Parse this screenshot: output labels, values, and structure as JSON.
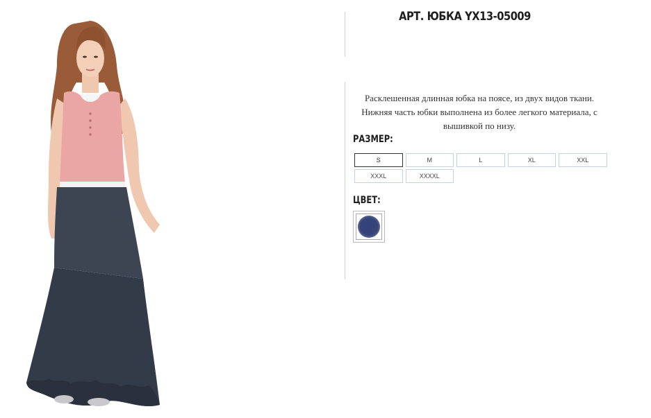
{
  "product": {
    "title": "АРТ. ЮБКА YX13-05009",
    "description": "Расклешенная длинная юбка на поясе, из двух видов ткани. Нижняя часть юбки выполнена из более легкого материала, с вышивкой по низу.",
    "photo_icon": "product-photo"
  },
  "size_section": {
    "label": "РАЗМЕР:",
    "options": [
      "S",
      "M",
      "L",
      "XL",
      "XXL",
      "XXXL",
      "XXXXL"
    ],
    "selected": "S"
  },
  "color_section": {
    "label": "ЦВЕТ:",
    "swatch_color": "#36447a"
  },
  "colors": {
    "skirt": "#3a404c",
    "top": "#e9a6a4",
    "divider": "#cfcfcf",
    "size_border": "#c4d2de"
  }
}
